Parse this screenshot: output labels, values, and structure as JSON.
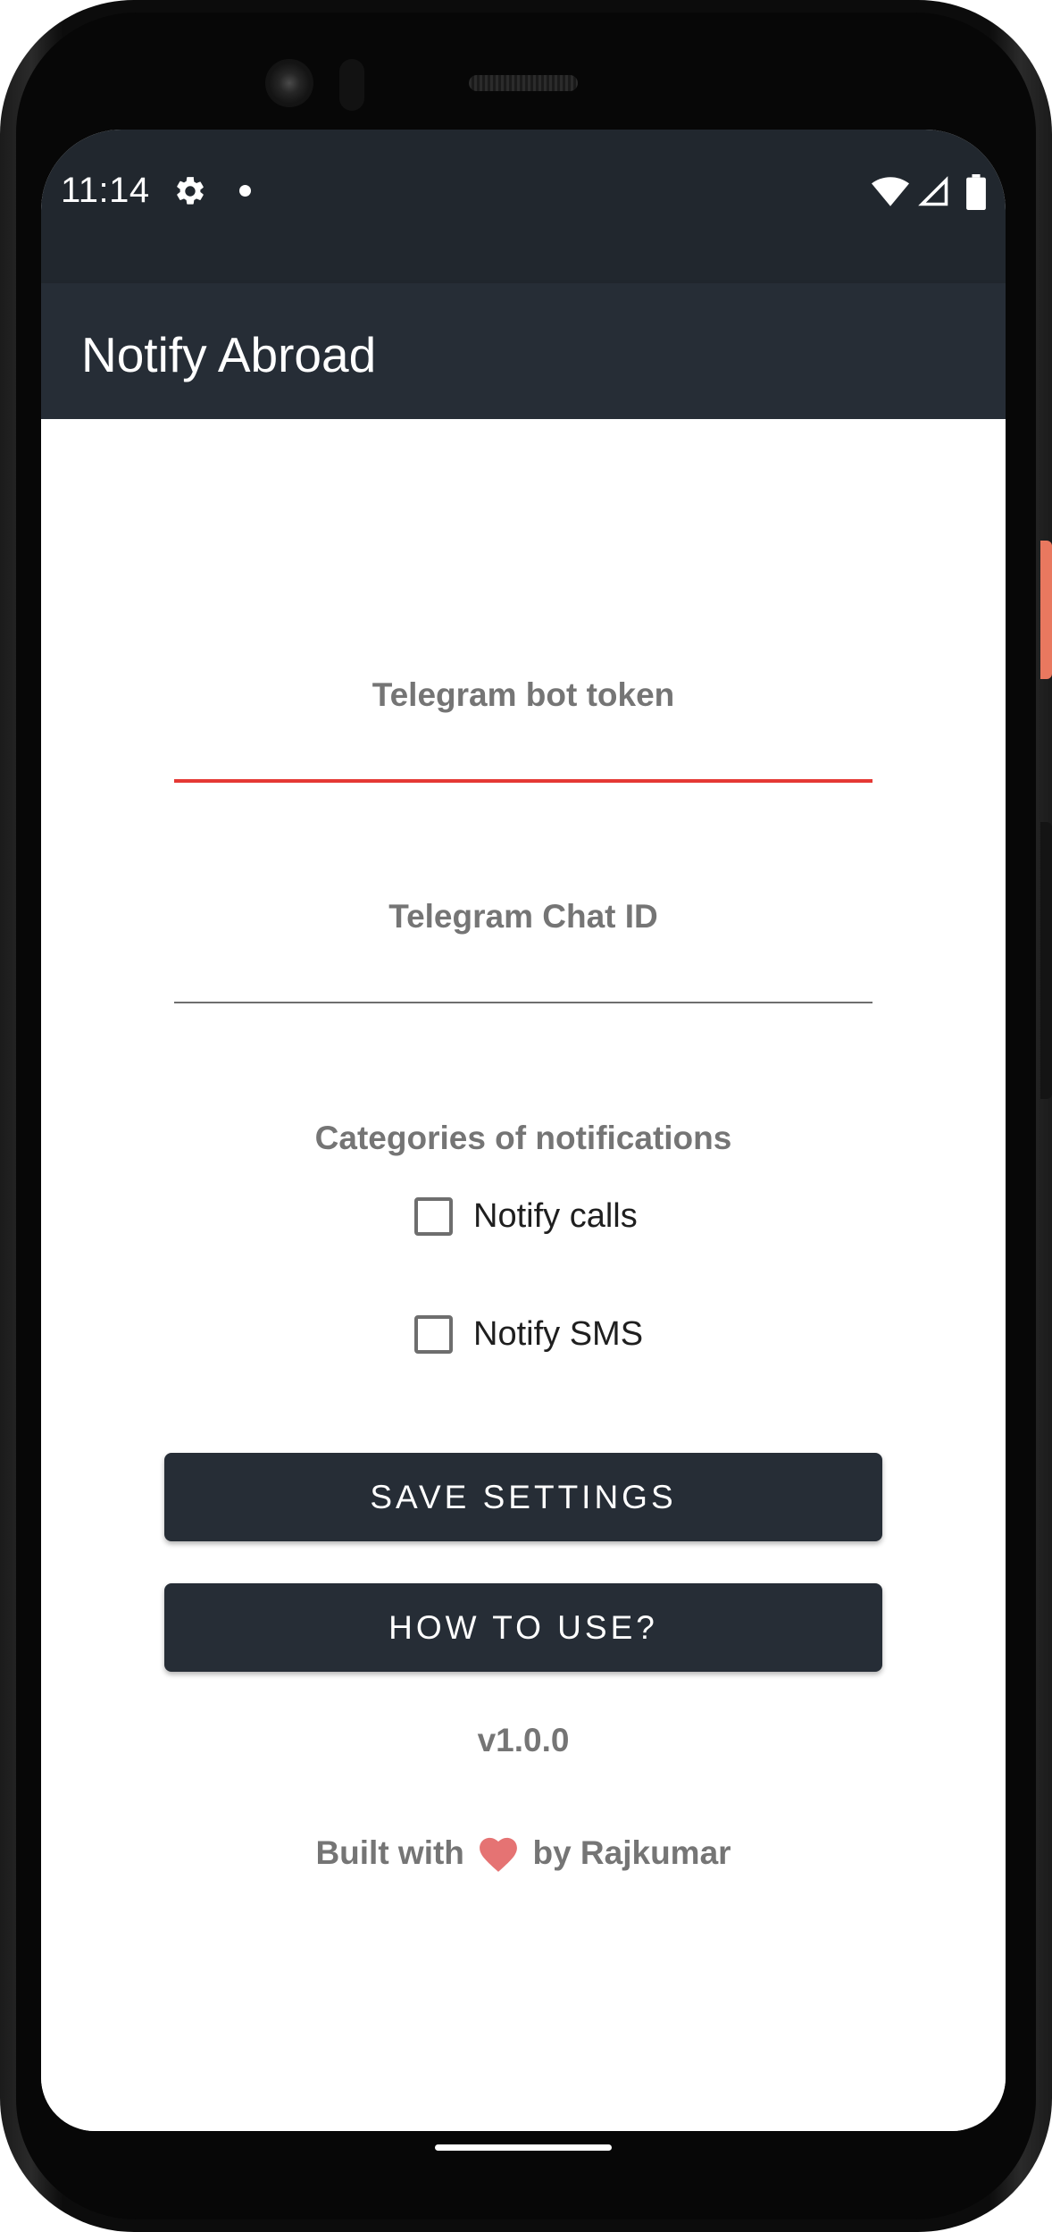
{
  "status_bar": {
    "time": "11:14",
    "icons": [
      "gear-icon",
      "notification-dot-icon",
      "wifi-icon",
      "signal-icon",
      "battery-icon"
    ]
  },
  "app_bar": {
    "title": "Notify Abroad"
  },
  "form": {
    "bot_token": {
      "label": "Telegram bot token",
      "value": "",
      "placeholder": ""
    },
    "chat_id": {
      "label": "Telegram Chat ID",
      "value": "",
      "placeholder": ""
    },
    "categories": {
      "label": "Categories of notifications",
      "options": [
        {
          "label": "Notify calls",
          "checked": false
        },
        {
          "label": "Notify SMS",
          "checked": false
        }
      ]
    }
  },
  "buttons": {
    "save_label": "SAVE SETTINGS",
    "how_to_label": "HOW TO USE?"
  },
  "footer": {
    "version": "v1.0.0",
    "built_prefix": "Built with",
    "built_suffix": "by Rajkumar",
    "heart_icon": "heart-icon"
  },
  "colors": {
    "status_bar": "#21272e",
    "app_bar": "#262d36",
    "button": "#262d36",
    "error_underline": "#e53935",
    "label_gray": "#757575",
    "heart": "#e57373"
  }
}
